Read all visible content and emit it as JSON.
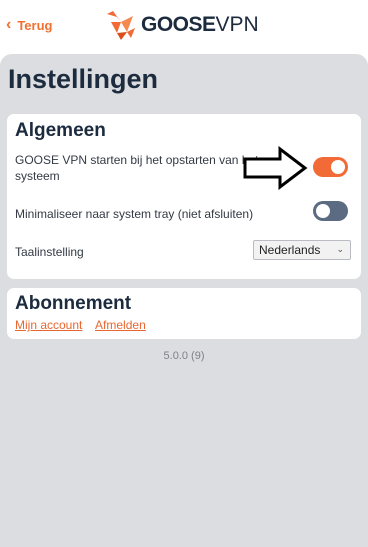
{
  "header": {
    "back_label": "Terug",
    "brand_left": "GOOSE",
    "brand_right": "VPN"
  },
  "page": {
    "title": "Instellingen"
  },
  "general": {
    "title": "Algemeen",
    "start_on_boot_label": "GOOSE VPN starten bij het opstarten van het systeem",
    "start_on_boot_on": true,
    "minimize_label": "Minimaliseer naar system tray (niet afsluiten)",
    "minimize_on": false,
    "language_label": "Taalinstelling",
    "language_value": "Nederlands"
  },
  "subscription": {
    "title": "Abonnement",
    "my_account": "Mijn account",
    "logout": "Afmelden"
  },
  "version": "5.0.0 (9)",
  "colors": {
    "accent": "#f26a35",
    "toggle_off": "#5a6b82",
    "panel": "#dcdde0",
    "text_dark": "#1c2b3e"
  },
  "icons": {
    "back": "chevron-left-icon",
    "logo": "goose-logo-icon",
    "pointer": "arrow-right-icon",
    "dropdown": "chevron-down-icon"
  }
}
